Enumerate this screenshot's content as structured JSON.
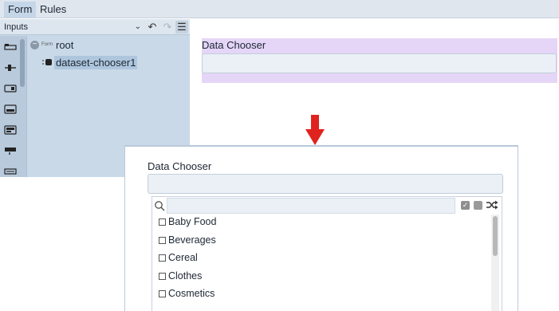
{
  "topbar": {
    "tabs": [
      {
        "label": "Form",
        "active": true
      },
      {
        "label": "Rules",
        "active": false
      }
    ]
  },
  "panel": {
    "inputs_select": "Inputs",
    "header_buttons": [
      "undo-icon",
      "redo-icon",
      "menu-icon"
    ],
    "palette_icons": [
      "text-input-icon",
      "slider-input-icon",
      "toggle-input-icon",
      "dropdown-input-icon",
      "combo-input-icon",
      "button-input-icon",
      "list-input-icon"
    ]
  },
  "tree": {
    "root_tag": "Form",
    "root_label": "root",
    "child_label": "dataset-chooser1"
  },
  "preview": {
    "label": "Data Chooser",
    "highlight_color": "#e5d6f7"
  },
  "zoom": {
    "label": "Data Chooser",
    "items": [
      "Baby Food",
      "Beverages",
      "Cereal",
      "Clothes",
      "Cosmetics"
    ],
    "check_glyph": "✓"
  },
  "colors": {
    "arrow": "#e0231f",
    "panel_bg": "#c9d9e8",
    "selected": "#aec6dd"
  }
}
